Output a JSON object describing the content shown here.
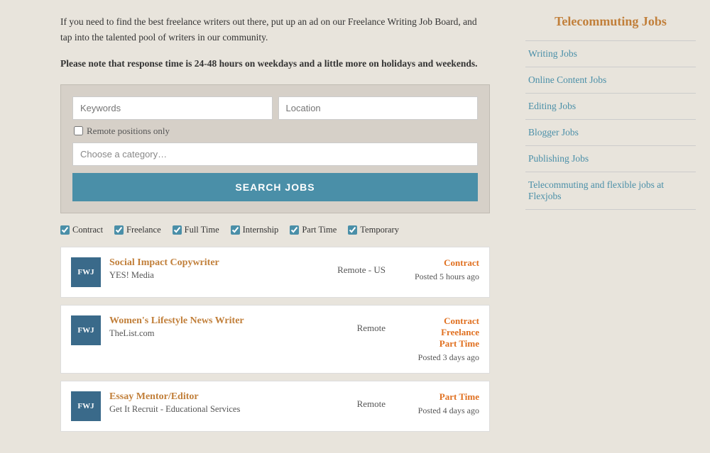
{
  "intro": {
    "paragraph1": "If you need to find the best freelance writers out there, put up an ad on our Freelance Writing Job Board, and tap into the talented pool of writers in our community.",
    "paragraph2": "Please note that response time is 24-48 hours on weekdays and a little more on holidays and weekends."
  },
  "search": {
    "keywords_placeholder": "Keywords",
    "location_placeholder": "Location",
    "remote_label": "Remote positions only",
    "category_placeholder": "Choose a category…",
    "button_label": "SEARCH JOBS"
  },
  "filters": [
    {
      "id": "contract",
      "label": "Contract",
      "checked": true
    },
    {
      "id": "freelance",
      "label": "Freelance",
      "checked": true
    },
    {
      "id": "fulltime",
      "label": "Full Time",
      "checked": true
    },
    {
      "id": "internship",
      "label": "Internship",
      "checked": true
    },
    {
      "id": "parttime",
      "label": "Part Time",
      "checked": true
    },
    {
      "id": "temporary",
      "label": "Temporary",
      "checked": true
    }
  ],
  "jobs": [
    {
      "logo": "FWJ",
      "title": "Social Impact Copywriter",
      "company": "YES! Media",
      "location": "Remote - US",
      "types": [
        "Contract"
      ],
      "posted": "Posted 5 hours ago"
    },
    {
      "logo": "FWJ",
      "title": "Women's Lifestyle News Writer",
      "company": "TheList.com",
      "location": "Remote",
      "types": [
        "Contract",
        "Freelance",
        "Part Time"
      ],
      "posted": "Posted 3 days ago"
    },
    {
      "logo": "FWJ",
      "title": "Essay Mentor/Editor",
      "company": "Get It Recruit - Educational Services",
      "location": "Remote",
      "types": [
        "Part Time"
      ],
      "posted": "Posted 4 days ago"
    }
  ],
  "sidebar": {
    "title": "Telecommuting Jobs",
    "links": [
      "Writing Jobs",
      "Online Content Jobs",
      "Editing Jobs",
      "Blogger Jobs",
      "Publishing Jobs",
      "Telecommuting and flexible jobs at Flexjobs"
    ]
  }
}
